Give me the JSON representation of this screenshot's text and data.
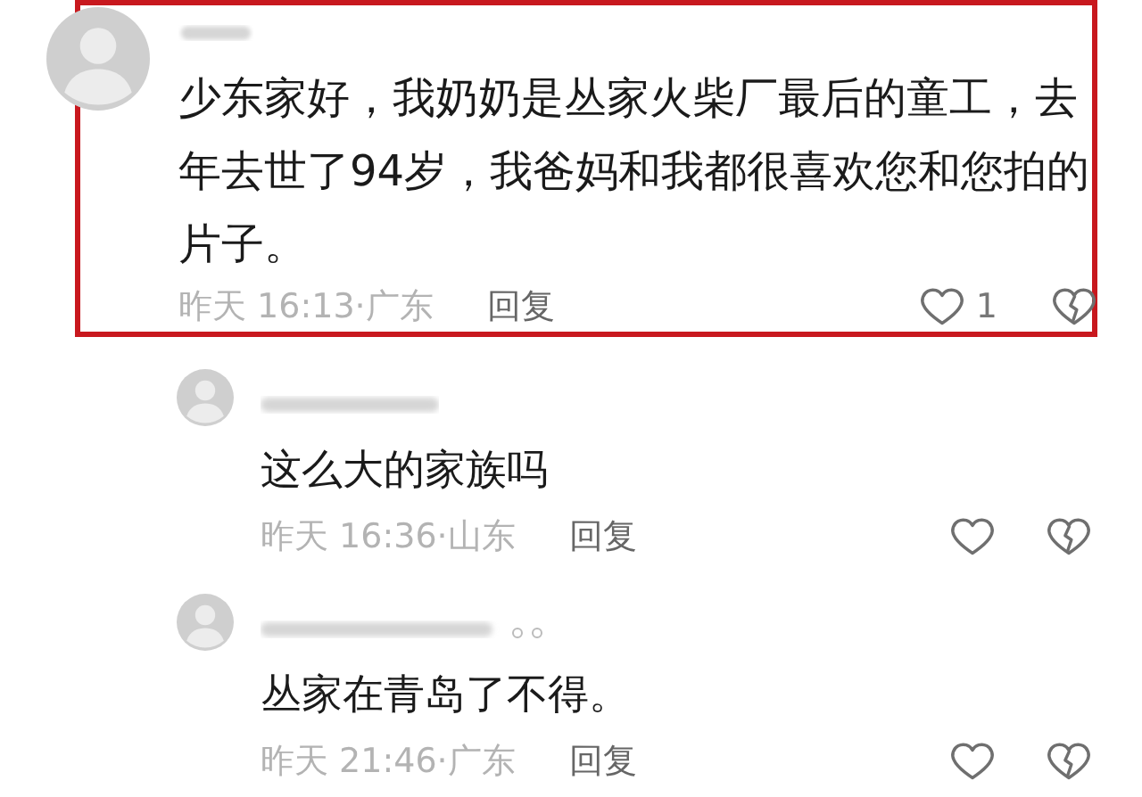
{
  "comments": [
    {
      "highlighted": true,
      "text": "少东家好，我奶奶是丛家火柴厂最后的童工，去年去世了94岁，我爸妈和我都很喜欢您和您拍的片子。",
      "meta": "昨天 16:13·广东",
      "reply_label": "回复",
      "likes": "1",
      "replies": [
        {
          "text": "这么大的家族吗",
          "meta": "昨天 16:36·山东",
          "reply_label": "回复"
        },
        {
          "text": "丛家在青岛了不得。",
          "meta": "昨天 21:46·广东",
          "reply_label": "回复"
        }
      ]
    }
  ]
}
